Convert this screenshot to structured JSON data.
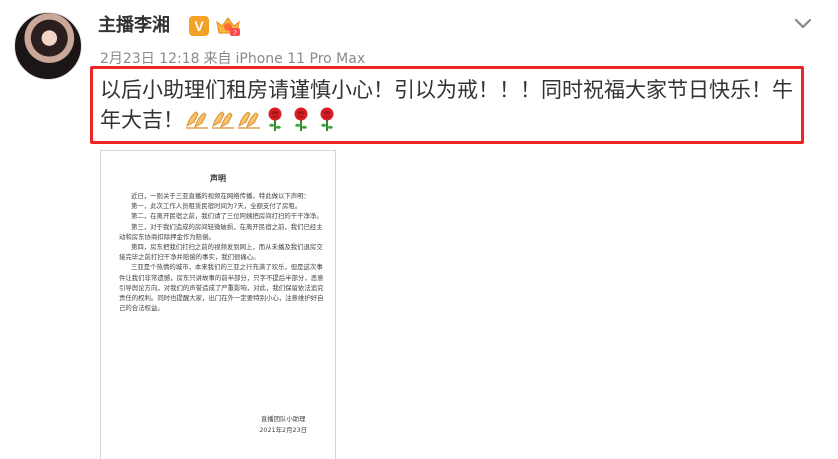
{
  "post": {
    "username": "主播李湘",
    "verified_badge": "V",
    "time": "2月23日 12:18",
    "source_prefix": "来自",
    "device": "iPhone 11 Pro Max",
    "text": "以后小助理们租房请谨慎小心！引以为戒！！！同时祝福大家节日快乐！牛年大吉！",
    "emojis": [
      "praying-hands",
      "praying-hands",
      "praying-hands",
      "rose",
      "rose",
      "rose"
    ],
    "highlight_color": "#ef2424"
  },
  "document": {
    "title": "声明",
    "paragraphs": [
      "近日，一则关于三亚直播的视频在网络传播，特此做以下声明：",
      "第一，此次工作人员租赁民宿时间为7天，全额支付了房租。",
      "第二，在离开民宿之前，我们请了三位阿姨把房间打扫的干干净净。",
      "第三，对于我们造成的房间轻微破损，在离开民宿之前，我们已经主动和房东协商扣除押金作为赔偿。",
      "第四，房东把我们打扫之前的视频发到网上，而从未播及我们退房交接完毕之前打扫干净并赔偿的事实，我们很痛心。",
      "三亚是个热情的城市，本来我们的三亚之行充满了欢乐，但是这次事件让我们非常遗憾，房东只讲故事的前半部分，只字不提后半部分，恶意引导舆论方向，对我们的声誉造成了严重影响，对此，我们保留依法追究责任的权利。同时也提醒大家，出门在外一定要特别小心，注意维护好自己的合法权益。"
    ],
    "signature": "直播团队小助理",
    "date": "2021年2月23日"
  }
}
